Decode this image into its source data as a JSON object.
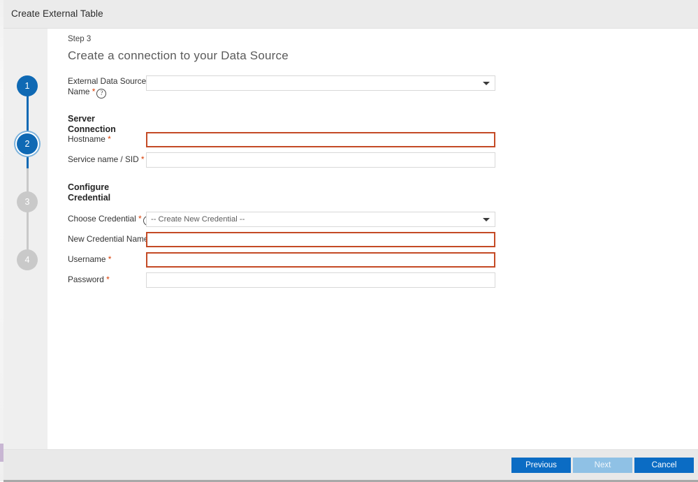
{
  "window": {
    "title": "Create External Table"
  },
  "stepper": {
    "steps": [
      {
        "number": "1",
        "state": "done"
      },
      {
        "number": "2",
        "state": "active"
      },
      {
        "number": "3",
        "state": "todo"
      },
      {
        "number": "4",
        "state": "todo"
      }
    ]
  },
  "main": {
    "step_label": "Step 3",
    "heading": "Create a connection to your Data Source",
    "external_data_source": {
      "label_line1": "External Data Source",
      "label_line2": "Name",
      "required_mark": "*",
      "help_icon": "help-circle-icon",
      "value": "",
      "placeholder": ""
    },
    "server_connection": {
      "section_title": "Server Connection",
      "hostname": {
        "label": "Hostname",
        "required_mark": "*",
        "value": "",
        "placeholder": "",
        "invalid": true
      },
      "service_name": {
        "label": "Service name / SID",
        "required_mark": "*",
        "value": "",
        "placeholder": "",
        "invalid": false
      }
    },
    "configure_credential": {
      "section_title_line1": "Configure",
      "section_title_line2": "Credential",
      "choose_credential": {
        "label": "Choose Credential",
        "required_mark": "*",
        "help_icon": "help-circle-icon",
        "selected": "-- Create New Credential --"
      },
      "new_credential_name": {
        "label": "New Credential Name",
        "required_mark": "*",
        "value": "",
        "placeholder": "",
        "invalid": true
      },
      "username": {
        "label": "Username",
        "required_mark": "*",
        "value": "",
        "placeholder": "",
        "invalid": true
      },
      "password": {
        "label": "Password",
        "required_mark": "*",
        "value": "",
        "placeholder": "",
        "invalid": false
      }
    }
  },
  "footer": {
    "previous_label": "Previous",
    "next_label": "Next",
    "cancel_label": "Cancel",
    "next_disabled": true
  },
  "colors": {
    "accent_blue": "#0b6cc4",
    "disabled_blue": "#8fc1e5",
    "error_red": "#c44a25",
    "required_asterisk": "#d83b01",
    "step_inactive": "#c9c9c9",
    "titlebar_bg": "#ebebeb",
    "panel_bg": "#ffffff",
    "body_bg": "#efefef"
  }
}
